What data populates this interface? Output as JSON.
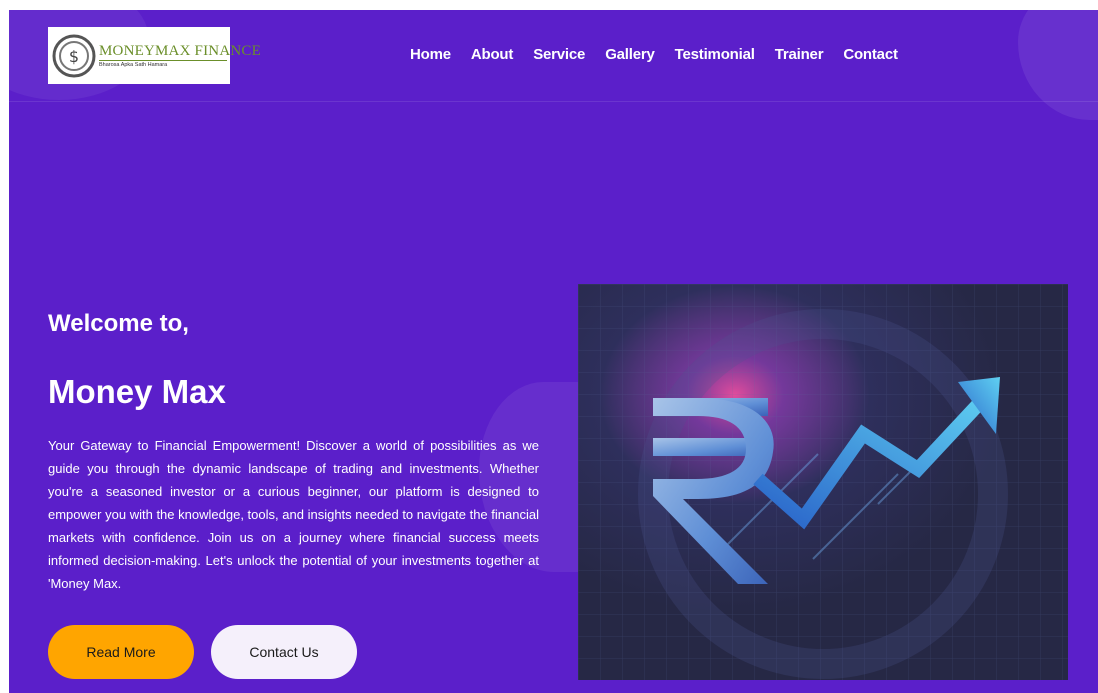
{
  "brand": {
    "name": "MONEYMAX FINANCE",
    "tagline": "Bharosa Apka Sath Hamara"
  },
  "nav": {
    "items": [
      "Home",
      "About",
      "Service",
      "Gallery",
      "Testimonial",
      "Trainer",
      "Contact"
    ]
  },
  "hero": {
    "welcome": "Welcome to,",
    "title": "Money Max",
    "description": "Your Gateway to Financial Empowerment! Discover a world of possibilities as we guide you through the dynamic landscape of trading and investments. Whether you're a seasoned investor or a curious beginner, our platform is designed to empower you with the knowledge, tools, and insights needed to navigate the financial markets with confidence. Join us on a journey where financial success meets informed decision-making. Let's unlock the potential of your investments together at 'Money Max.",
    "read_more_label": "Read More",
    "contact_label": "Contact Us",
    "image_icon": "rupee-growth-arrow-icon"
  },
  "colors": {
    "background": "#5b1fca",
    "primary_button": "#ffa500",
    "secondary_button": "#f5f0fb",
    "text": "#ffffff"
  }
}
